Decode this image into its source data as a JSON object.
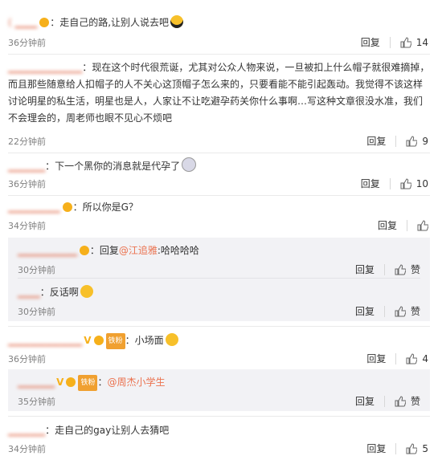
{
  "comments": [
    {
      "name": "( ▁▁▁",
      "text": "走自己的路,让别人说去吧",
      "time": "36分钟前",
      "likes": "14"
    },
    {
      "name": "▁▁▁▁▁▁▁▁▁▁",
      "text": "现在这个时代很荒诞，尤其对公众人物来说，一旦被扣上什么帽子就很难摘掉，而且那些随意给人扣帽子的人不关心这顶帽子怎么来的，只要看能不能引起轰动。我觉得不该这样讨论明星的私生活，明星也是人，人家让不让吃避孕药关你什么事啊…写这种文章很没水准，我们不会理会的，周老师也眼不见心不烦吧",
      "time": "22分钟前",
      "likes": "9"
    },
    {
      "name": "▁▁▁▁▁",
      "text": "下一个黑你的消息就是代孕了",
      "time": "36分钟前",
      "likes": "10"
    },
    {
      "name": "▁▁▁▁▁▁▁",
      "text": "所以你是G？",
      "time": "34分钟前",
      "likes": ""
    },
    {
      "name": "▁▁▁▁▁▁▁▁▁▁",
      "text": "小场面",
      "time": "36分钟前",
      "likes": "4"
    },
    {
      "name": "▁▁▁▁▁",
      "text": "走自己的gay让别人去猜吧",
      "time": "34分钟前",
      "likes": "5"
    }
  ],
  "replies": [
    {
      "name": "▁▁▁▁▁▁▁▁",
      "prefix": "回复",
      "mention": "@江追雅",
      "text": ":哈哈哈哈",
      "time": "30分钟前",
      "likes": "赞"
    },
    {
      "name": "▁▁▁",
      "text": "反话啊",
      "time": "30分钟前",
      "likes": "赞"
    },
    {
      "name": "▁▁▁▁▁",
      "mention": "@周杰小学生",
      "time": "35分钟前",
      "likes": "赞"
    }
  ],
  "labels": {
    "reply": "回复",
    "colon": "：",
    "fan": "铁粉"
  },
  "icons": [
    "thumb-up-icon",
    "cool-emoji-icon",
    "shocked-emoji-icon",
    "laugh-emoji-icon",
    "smug-emoji-icon",
    "verified-badge-icon"
  ],
  "colors": {
    "name": "#e06a4a",
    "mention": "#eb7350",
    "time": "#808080",
    "nested_bg": "#f2f2f5"
  }
}
